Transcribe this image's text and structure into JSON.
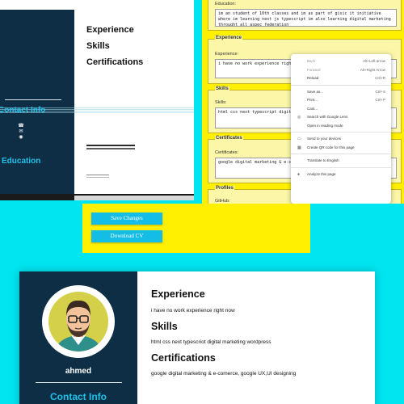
{
  "preview_top": {
    "headings": [
      "Experience",
      "Skills",
      "Certifications"
    ],
    "sidebar_contact": "Contact Info",
    "sidebar_education": "Education",
    "contact_icons": [
      "phone-icon",
      "mail-icon",
      "location-icon"
    ]
  },
  "form": {
    "education_label": "Education:",
    "education_text": "im an student of 10th classes and im as part of gisic it initiative where im learning next js typescript im also learning digital marketing throught all aspec federation",
    "experience_title": "Experience",
    "experience_label": "Experience:",
    "experience_text": "i have no work experience right",
    "skills_title": "Skills",
    "skills_label": "Skills:",
    "skills_text": "html css next typescript digite",
    "certificates_title": "Certificates",
    "certificates_label": "Certificates:",
    "certificates_text": "google digital marketing & e-com",
    "profiles_title": "Profiles",
    "github_label": "GitHub:"
  },
  "context_menu": {
    "items": [
      {
        "label": "Back",
        "shortcut": "Alt+Left arrow",
        "disabled": true
      },
      {
        "label": "Forward",
        "shortcut": "Alt+Right Arrow",
        "disabled": true
      },
      {
        "label": "Reload",
        "shortcut": "Ctrl+R",
        "disabled": false
      },
      {
        "sep": true
      },
      {
        "label": "Save as...",
        "shortcut": "Ctrl+S",
        "disabled": false
      },
      {
        "label": "Print...",
        "shortcut": "Ctrl+P",
        "disabled": false
      },
      {
        "label": "Cast...",
        "shortcut": "",
        "disabled": false
      },
      {
        "label": "Search with Google Lens",
        "shortcut": "",
        "icon": "lens-icon",
        "disabled": false
      },
      {
        "label": "Open in reading mode",
        "shortcut": "",
        "disabled": false
      },
      {
        "sep": true
      },
      {
        "label": "Send to your devices",
        "shortcut": "",
        "icon": "devices-icon",
        "disabled": false
      },
      {
        "label": "Create QR code for this page",
        "shortcut": "",
        "icon": "qr-icon",
        "disabled": false
      },
      {
        "sep": true
      },
      {
        "label": "Translate to English",
        "shortcut": "",
        "disabled": false
      },
      {
        "sep": true
      },
      {
        "label": "Analyze this page",
        "shortcut": "",
        "icon": "analyze-icon",
        "disabled": false
      }
    ]
  },
  "actions": {
    "save_label": "Save Changes",
    "download_label": "Download CV"
  },
  "cv": {
    "name": "ahmed",
    "contact_heading": "Contact Info",
    "experience_heading": "Experience",
    "experience_text": "i have no work experience right now",
    "skills_heading": "Skills",
    "skills_text": "html css next typescriot digital marketing wordpress",
    "certifications_heading": "Certifications",
    "certifications_text": "google digital marketing & e-comerce, google UX,UI designing"
  },
  "colors": {
    "background": "#00e5f0",
    "sidebar": "#0d2e44",
    "accent": "#1fc0ea",
    "form_bg": "#ffef00",
    "button": "#13bde6"
  }
}
